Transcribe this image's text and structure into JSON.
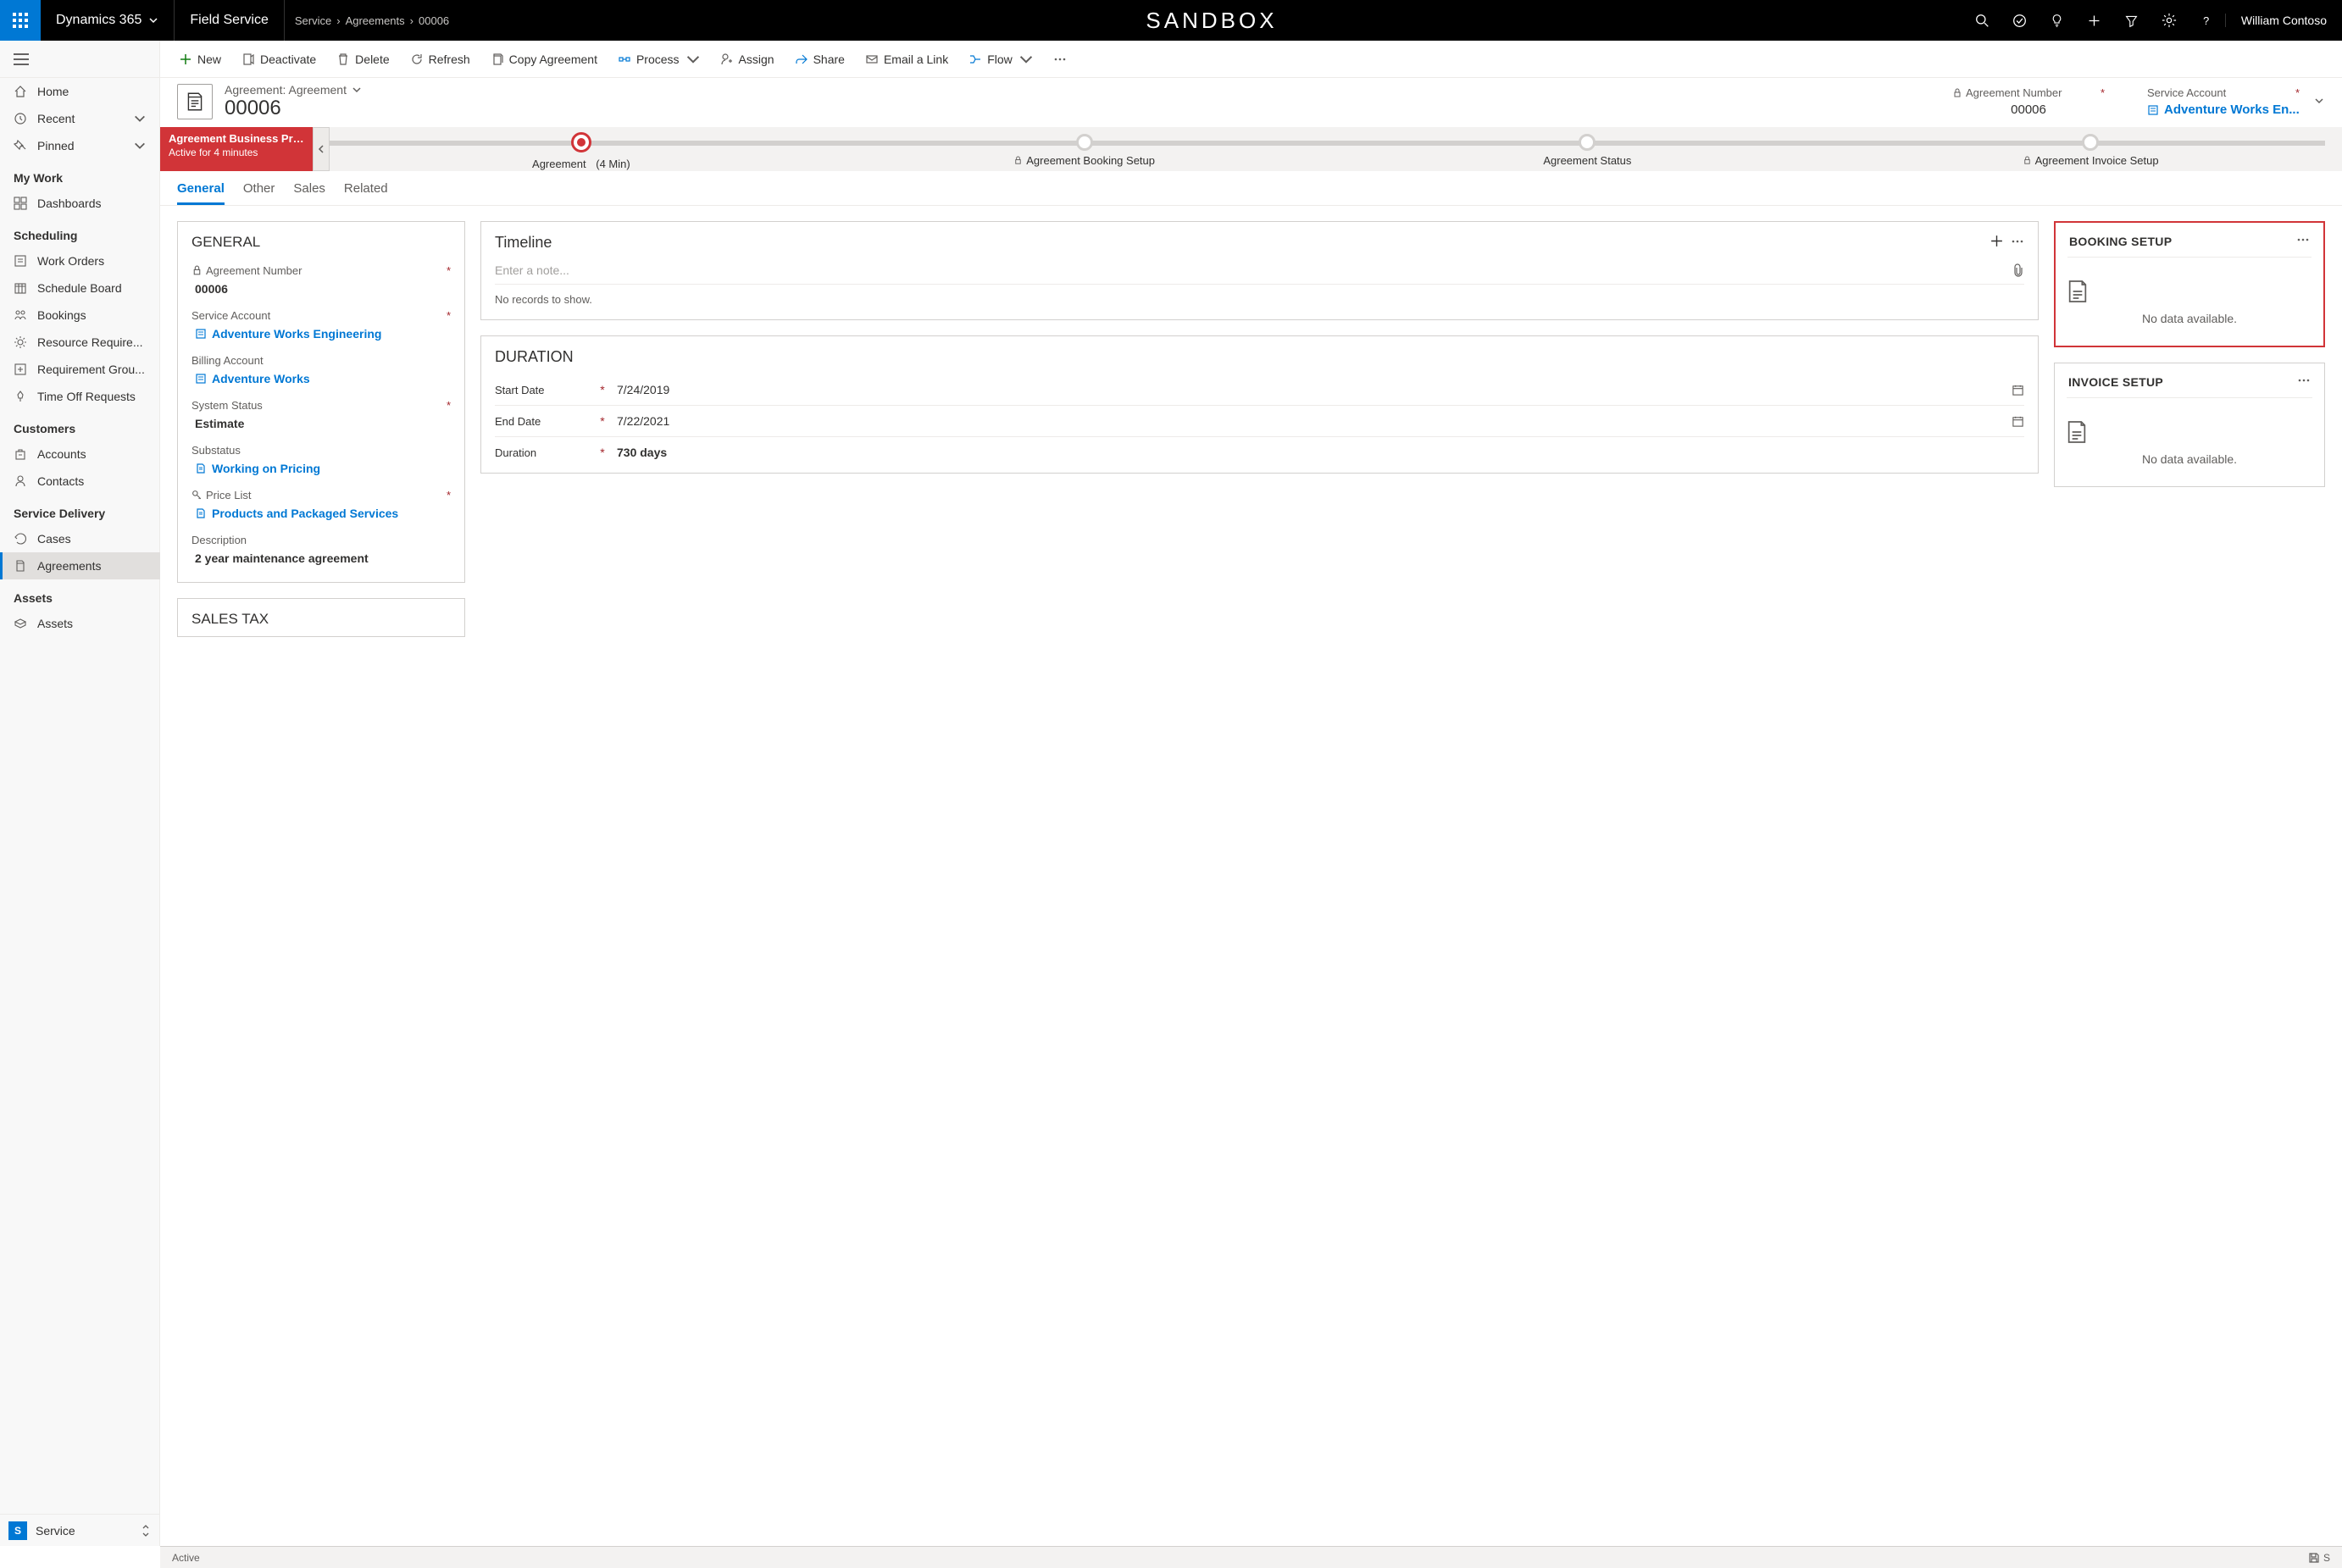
{
  "topbar": {
    "brand": "Dynamics 365",
    "module": "Field Service",
    "breadcrumb": [
      "Service",
      "Agreements",
      "00006"
    ],
    "sandbox": "SANDBOX",
    "user": "William Contoso"
  },
  "commands": {
    "new": "New",
    "deactivate": "Deactivate",
    "delete": "Delete",
    "refresh": "Refresh",
    "copy": "Copy Agreement",
    "process": "Process",
    "assign": "Assign",
    "share": "Share",
    "email": "Email a Link",
    "flow": "Flow"
  },
  "sidebar": {
    "home": "Home",
    "recent": "Recent",
    "pinned": "Pinned",
    "group_mywork": "My Work",
    "dashboards": "Dashboards",
    "group_scheduling": "Scheduling",
    "work_orders": "Work Orders",
    "schedule_board": "Schedule Board",
    "bookings": "Bookings",
    "resource_req": "Resource Require...",
    "requirement_grp": "Requirement Grou...",
    "time_off": "Time Off Requests",
    "group_customers": "Customers",
    "accounts": "Accounts",
    "contacts": "Contacts",
    "group_delivery": "Service Delivery",
    "cases": "Cases",
    "agreements": "Agreements",
    "group_assets": "Assets",
    "assets": "Assets",
    "area_badge": "S",
    "area_name": "Service"
  },
  "header": {
    "subtitle": "Agreement: Agreement",
    "title": "00006",
    "agreement_number_label": "Agreement Number",
    "agreement_number_value": "00006",
    "service_account_label": "Service Account",
    "service_account_value": "Adventure Works En..."
  },
  "process": {
    "name": "Agreement Business Pro...",
    "duration_line": "Active for 4 minutes",
    "stage1": "Agreement",
    "stage1_dur": "(4 Min)",
    "stage2": "Agreement Booking Setup",
    "stage3": "Agreement Status",
    "stage4": "Agreement Invoice Setup"
  },
  "tabs": {
    "general": "General",
    "other": "Other",
    "sales": "Sales",
    "related": "Related"
  },
  "general_card": {
    "title": "GENERAL",
    "agreement_number_label": "Agreement Number",
    "agreement_number_value": "00006",
    "service_account_label": "Service Account",
    "service_account_value": "Adventure Works Engineering",
    "billing_account_label": "Billing Account",
    "billing_account_value": "Adventure Works",
    "system_status_label": "System Status",
    "system_status_value": "Estimate",
    "substatus_label": "Substatus",
    "substatus_value": "Working on Pricing",
    "price_list_label": "Price List",
    "price_list_value": "Products and Packaged Services",
    "description_label": "Description",
    "description_value": "2 year maintenance agreement"
  },
  "sales_tax_card": {
    "title": "SALES TAX"
  },
  "timeline_card": {
    "title": "Timeline",
    "placeholder": "Enter a note...",
    "empty": "No records to show."
  },
  "duration_card": {
    "title": "DURATION",
    "start_label": "Start Date",
    "start_value": "7/24/2019",
    "end_label": "End Date",
    "end_value": "7/22/2021",
    "duration_label": "Duration",
    "duration_value": "730 days"
  },
  "booking_card": {
    "title": "BOOKING SETUP",
    "empty": "No data available."
  },
  "invoice_card": {
    "title": "INVOICE SETUP",
    "empty": "No data available."
  },
  "statusbar": {
    "status": "Active",
    "save_hint": "S"
  }
}
